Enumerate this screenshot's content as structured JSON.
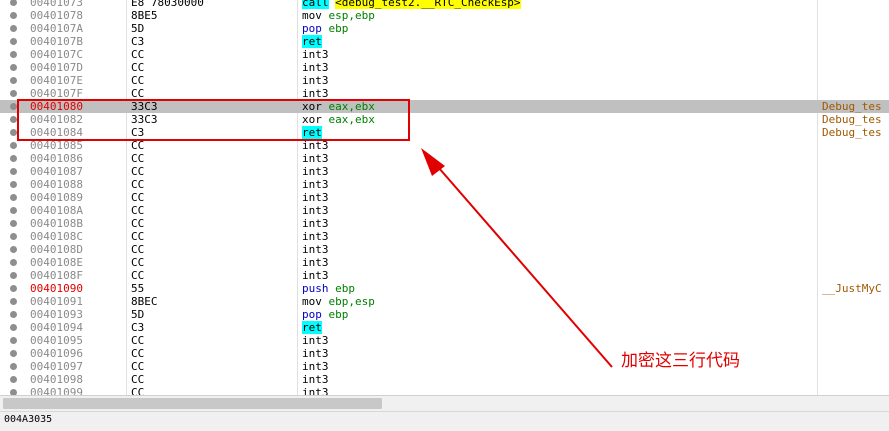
{
  "rows": [
    {
      "addr": "00401073",
      "hex": "E8 78030000",
      "op": "call",
      "ops": "",
      "target": "<debug_test2.__RTC_CheckEsp>",
      "comment": "",
      "addr_red": false
    },
    {
      "addr": "00401078",
      "hex": "8BE5",
      "op": "mov",
      "ops": "esp,ebp",
      "target": "",
      "comment": "",
      "addr_red": false
    },
    {
      "addr": "0040107A",
      "hex": "5D",
      "op": "pop",
      "ops": "ebp",
      "target": "",
      "comment": "",
      "addr_red": false
    },
    {
      "addr": "0040107B",
      "hex": "C3",
      "op": "ret",
      "ops": "",
      "target": "",
      "comment": "",
      "addr_red": false
    },
    {
      "addr": "0040107C",
      "hex": "CC",
      "op": "int3",
      "ops": "",
      "target": "",
      "comment": "",
      "addr_red": false
    },
    {
      "addr": "0040107D",
      "hex": "CC",
      "op": "int3",
      "ops": "",
      "target": "",
      "comment": "",
      "addr_red": false
    },
    {
      "addr": "0040107E",
      "hex": "CC",
      "op": "int3",
      "ops": "",
      "target": "",
      "comment": "",
      "addr_red": false
    },
    {
      "addr": "0040107F",
      "hex": "CC",
      "op": "int3",
      "ops": "",
      "target": "",
      "comment": "",
      "addr_red": false
    },
    {
      "addr": "00401080",
      "hex": "33C3",
      "op": "xor",
      "ops": "eax,ebx",
      "target": "",
      "comment": "Debug_tes",
      "addr_red": true,
      "selected": true
    },
    {
      "addr": "00401082",
      "hex": "33C3",
      "op": "xor",
      "ops": "eax,ebx",
      "target": "",
      "comment": "Debug_tes",
      "addr_red": false
    },
    {
      "addr": "00401084",
      "hex": "C3",
      "op": "ret",
      "ops": "",
      "target": "",
      "comment": "Debug_tes",
      "addr_red": false
    },
    {
      "addr": "00401085",
      "hex": "CC",
      "op": "int3",
      "ops": "",
      "target": "",
      "comment": "",
      "addr_red": false
    },
    {
      "addr": "00401086",
      "hex": "CC",
      "op": "int3",
      "ops": "",
      "target": "",
      "comment": "",
      "addr_red": false
    },
    {
      "addr": "00401087",
      "hex": "CC",
      "op": "int3",
      "ops": "",
      "target": "",
      "comment": "",
      "addr_red": false
    },
    {
      "addr": "00401088",
      "hex": "CC",
      "op": "int3",
      "ops": "",
      "target": "",
      "comment": "",
      "addr_red": false
    },
    {
      "addr": "00401089",
      "hex": "CC",
      "op": "int3",
      "ops": "",
      "target": "",
      "comment": "",
      "addr_red": false
    },
    {
      "addr": "0040108A",
      "hex": "CC",
      "op": "int3",
      "ops": "",
      "target": "",
      "comment": "",
      "addr_red": false
    },
    {
      "addr": "0040108B",
      "hex": "CC",
      "op": "int3",
      "ops": "",
      "target": "",
      "comment": "",
      "addr_red": false
    },
    {
      "addr": "0040108C",
      "hex": "CC",
      "op": "int3",
      "ops": "",
      "target": "",
      "comment": "",
      "addr_red": false
    },
    {
      "addr": "0040108D",
      "hex": "CC",
      "op": "int3",
      "ops": "",
      "target": "",
      "comment": "",
      "addr_red": false
    },
    {
      "addr": "0040108E",
      "hex": "CC",
      "op": "int3",
      "ops": "",
      "target": "",
      "comment": "",
      "addr_red": false
    },
    {
      "addr": "0040108F",
      "hex": "CC",
      "op": "int3",
      "ops": "",
      "target": "",
      "comment": "",
      "addr_red": false
    },
    {
      "addr": "00401090",
      "hex": "55",
      "op": "push",
      "ops": "ebp",
      "target": "",
      "comment": "__JustMyC",
      "addr_red": true
    },
    {
      "addr": "00401091",
      "hex": "8BEC",
      "op": "mov",
      "ops": "ebp,esp",
      "target": "",
      "comment": "",
      "addr_red": false
    },
    {
      "addr": "00401093",
      "hex": "5D",
      "op": "pop",
      "ops": "ebp",
      "target": "",
      "comment": "",
      "addr_red": false
    },
    {
      "addr": "00401094",
      "hex": "C3",
      "op": "ret",
      "ops": "",
      "target": "",
      "comment": "",
      "addr_red": false
    },
    {
      "addr": "00401095",
      "hex": "CC",
      "op": "int3",
      "ops": "",
      "target": "",
      "comment": "",
      "addr_red": false
    },
    {
      "addr": "00401096",
      "hex": "CC",
      "op": "int3",
      "ops": "",
      "target": "",
      "comment": "",
      "addr_red": false
    },
    {
      "addr": "00401097",
      "hex": "CC",
      "op": "int3",
      "ops": "",
      "target": "",
      "comment": "",
      "addr_red": false
    },
    {
      "addr": "00401098",
      "hex": "CC",
      "op": "int3",
      "ops": "",
      "target": "",
      "comment": "",
      "addr_red": false
    },
    {
      "addr": "00401099",
      "hex": "CC",
      "op": "int3",
      "ops": "",
      "target": "",
      "comment": "",
      "addr_red": false
    }
  ],
  "annotation": {
    "text": "加密这三行代码"
  },
  "status": {
    "text": "004A3035"
  },
  "colors": {
    "annotation": "#e00000",
    "selection": "#c0c0c0",
    "highlight": "#00ffff",
    "call_target": "#ffff00",
    "comment": "#a05a00"
  }
}
